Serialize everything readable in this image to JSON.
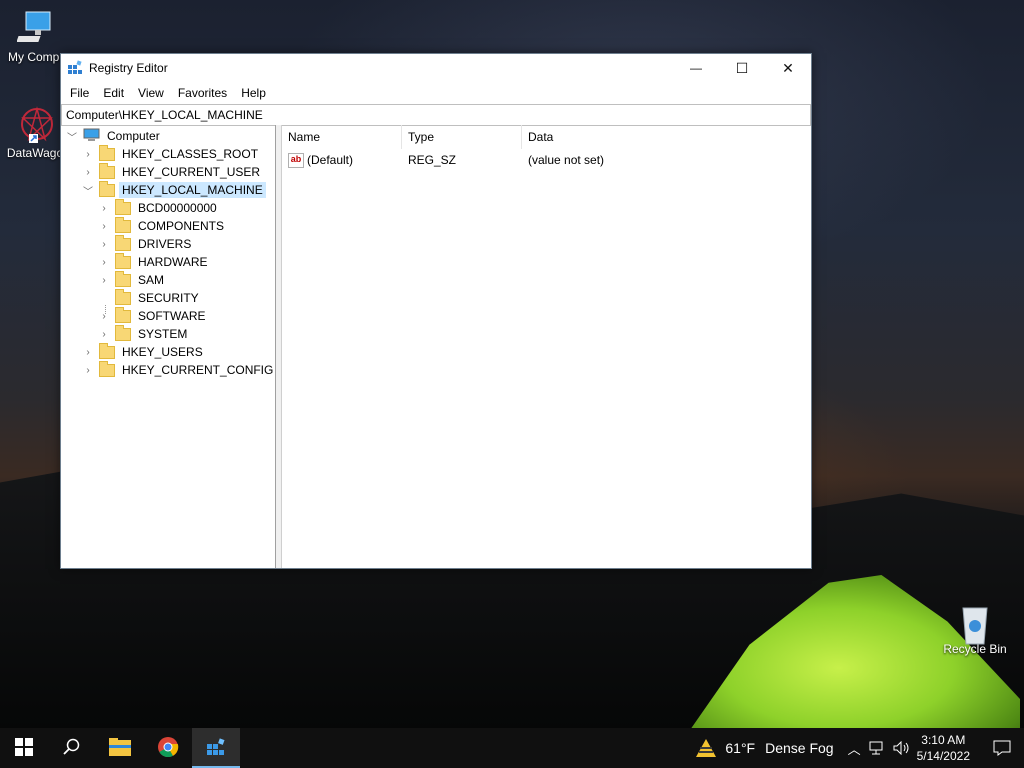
{
  "desktop": {
    "icons": [
      {
        "label": "My Compu"
      },
      {
        "label": "DataWago"
      },
      {
        "label": "Recycle Bin"
      }
    ]
  },
  "window": {
    "title": "Registry Editor",
    "controls": {
      "minimize": "—",
      "maximize": "☐",
      "close": "✕"
    },
    "menu": [
      "File",
      "Edit",
      "View",
      "Favorites",
      "Help"
    ],
    "address": "Computer\\HKEY_LOCAL_MACHINE"
  },
  "tree": {
    "root": "Computer",
    "hives": [
      {
        "label": "HKEY_CLASSES_ROOT",
        "expanded": false
      },
      {
        "label": "HKEY_CURRENT_USER",
        "expanded": false
      },
      {
        "label": "HKEY_LOCAL_MACHINE",
        "expanded": true,
        "selected": true
      },
      {
        "label": "HKEY_USERS",
        "expanded": false
      },
      {
        "label": "HKEY_CURRENT_CONFIG",
        "expanded": false
      }
    ],
    "hklm_children": [
      "BCD00000000",
      "COMPONENTS",
      "DRIVERS",
      "HARDWARE",
      "SAM",
      "SECURITY",
      "SOFTWARE",
      "SYSTEM"
    ]
  },
  "list": {
    "columns": [
      "Name",
      "Type",
      "Data"
    ],
    "rows": [
      {
        "name": "(Default)",
        "type": "REG_SZ",
        "data": "(value not set)",
        "icon_text": "ab"
      }
    ]
  },
  "taskbar": {
    "weather": {
      "temp": "61°F",
      "condition": "Dense Fog"
    },
    "clock": {
      "time": "3:10 AM",
      "date": "5/14/2022"
    }
  }
}
